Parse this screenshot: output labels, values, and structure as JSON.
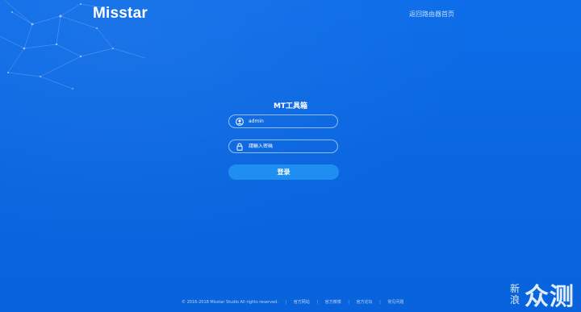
{
  "brand": "Misstar",
  "header": {
    "back_link": "返回路由器首页"
  },
  "login": {
    "title": "MT工具箱",
    "username_value": "admin",
    "password_placeholder": "請輸入密碼",
    "submit_label": "登录"
  },
  "footer": {
    "copyright": "© 2016-2018 Misstar Studio All rights reserved.",
    "links": [
      "官方网站",
      "官方微博",
      "官方论坛",
      "常见问题"
    ]
  },
  "watermark": {
    "small": "新浪",
    "big": "众测"
  },
  "colors": {
    "background": "#0a6ae6",
    "button": "#1e8ef0",
    "text": "#ffffff"
  },
  "icons": {
    "user": "user-circle-icon",
    "password": "lock-icon"
  }
}
